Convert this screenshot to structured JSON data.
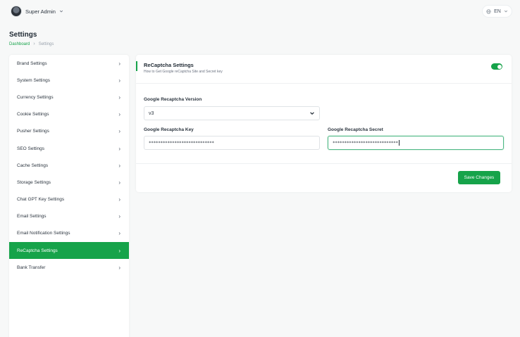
{
  "user": {
    "name": "Super Admin"
  },
  "language": {
    "current": "EN"
  },
  "page": {
    "title": "Settings"
  },
  "breadcrumb": {
    "home": "Dashboard",
    "current": "Settings"
  },
  "sidebar": {
    "items": [
      {
        "label": "Brand Settings"
      },
      {
        "label": "System Settings"
      },
      {
        "label": "Currency Settings"
      },
      {
        "label": "Cookie Settings"
      },
      {
        "label": "Pusher Settings"
      },
      {
        "label": "SEO Settings"
      },
      {
        "label": "Cache Settings"
      },
      {
        "label": "Storage Settings"
      },
      {
        "label": "Chat GPT Key Settings"
      },
      {
        "label": "Email Settings"
      },
      {
        "label": "Email Notification Settings"
      },
      {
        "label": "ReCaptcha Settings",
        "active": true
      },
      {
        "label": "Bank Transfer"
      }
    ]
  },
  "recaptcha": {
    "title": "ReCaptcha Settings",
    "subtitle": "How to Get Google reCaptcha Site and Secret key",
    "enabled": true,
    "version_label": "Google Recaptcha Version",
    "version_value": "v3",
    "key_label": "Google Recaptcha Key",
    "key_value": "****************************",
    "secret_label": "Google Recaptcha Secret",
    "secret_value": "****************************",
    "save_label": "Save Changes"
  },
  "colors": {
    "accent": "#16a34a"
  }
}
